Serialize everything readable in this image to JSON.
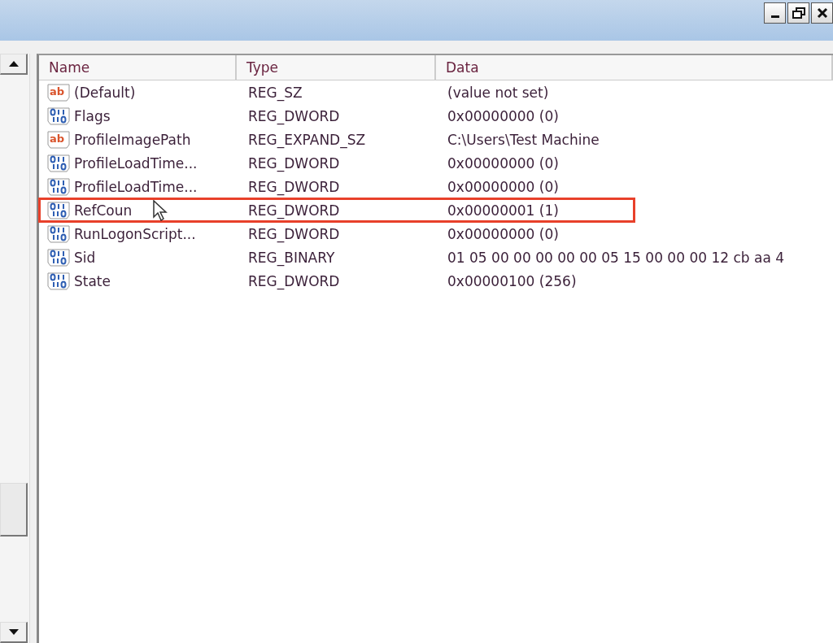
{
  "window": {
    "controls": [
      {
        "kind": "minimize"
      },
      {
        "kind": "restore"
      },
      {
        "kind": "close"
      }
    ]
  },
  "columns": [
    "Name",
    "Type",
    "Data"
  ],
  "rows": [
    {
      "kind": "string",
      "icon_text": "ab",
      "name": "(Default)",
      "type": "REG_SZ",
      "data": "(value not set)",
      "highlighted": false
    },
    {
      "kind": "binary",
      "name": "Flags",
      "type": "REG_DWORD",
      "data": "0x00000000 (0)",
      "highlighted": false
    },
    {
      "kind": "string",
      "icon_text": "ab",
      "name": "ProfileImagePath",
      "type": "REG_EXPAND_SZ",
      "data": "C:\\Users\\Test Machine",
      "highlighted": false
    },
    {
      "kind": "binary",
      "name": "ProfileLoadTime...",
      "type": "REG_DWORD",
      "data": "0x00000000 (0)",
      "highlighted": false
    },
    {
      "kind": "binary",
      "name": "ProfileLoadTime...",
      "type": "REG_DWORD",
      "data": "0x00000000 (0)",
      "highlighted": false
    },
    {
      "kind": "binary",
      "name": "RefCoun",
      "type": "REG_DWORD",
      "data": "0x00000001 (1)",
      "highlighted": true
    },
    {
      "kind": "binary",
      "name": "RunLogonScript...",
      "type": "REG_DWORD",
      "data": "0x00000000 (0)",
      "highlighted": false
    },
    {
      "kind": "binary",
      "name": "Sid",
      "type": "REG_BINARY",
      "data": "01 05 00 00 00 00 00 05 15 00 00 00 12 cb aa 4",
      "highlighted": false
    },
    {
      "kind": "binary",
      "name": "State",
      "type": "REG_DWORD",
      "data": "0x00000100 (256)",
      "highlighted": false
    }
  ]
}
